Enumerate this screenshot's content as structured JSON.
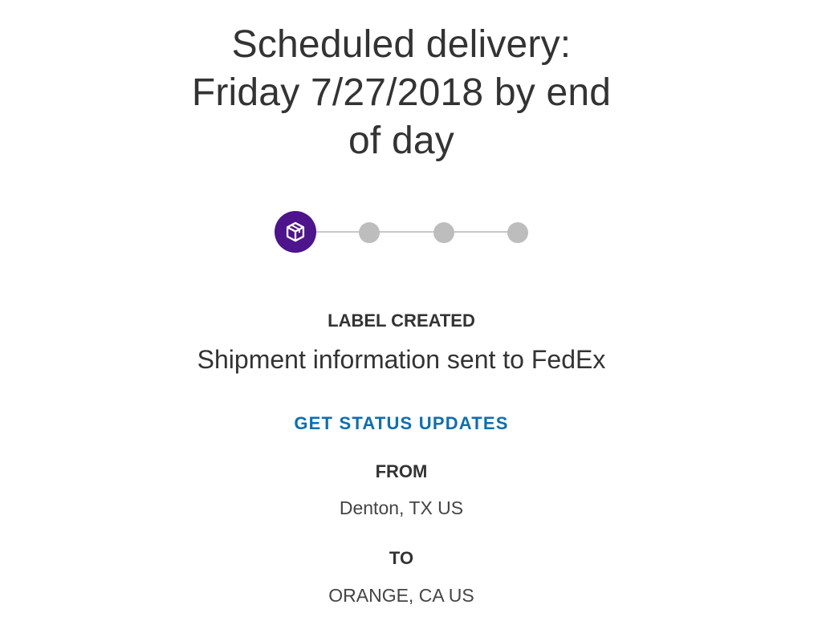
{
  "delivery": {
    "line1": "Scheduled delivery:",
    "line2": "Friday 7/27/2018 by end",
    "line3": "of day"
  },
  "progress": {
    "current_step": 1,
    "total_steps": 4,
    "current_icon": "package-icon",
    "active_color": "#4d148c",
    "inactive_color": "#bdbdbd"
  },
  "status": {
    "label": "LABEL CREATED",
    "description": "Shipment information sent to FedEx"
  },
  "actions": {
    "status_updates_link": "GET STATUS UPDATES",
    "link_color": "#0b6eb5"
  },
  "origin": {
    "label": "FROM",
    "value": "Denton, TX US"
  },
  "destination": {
    "label": "TO",
    "value": "ORANGE, CA US"
  }
}
